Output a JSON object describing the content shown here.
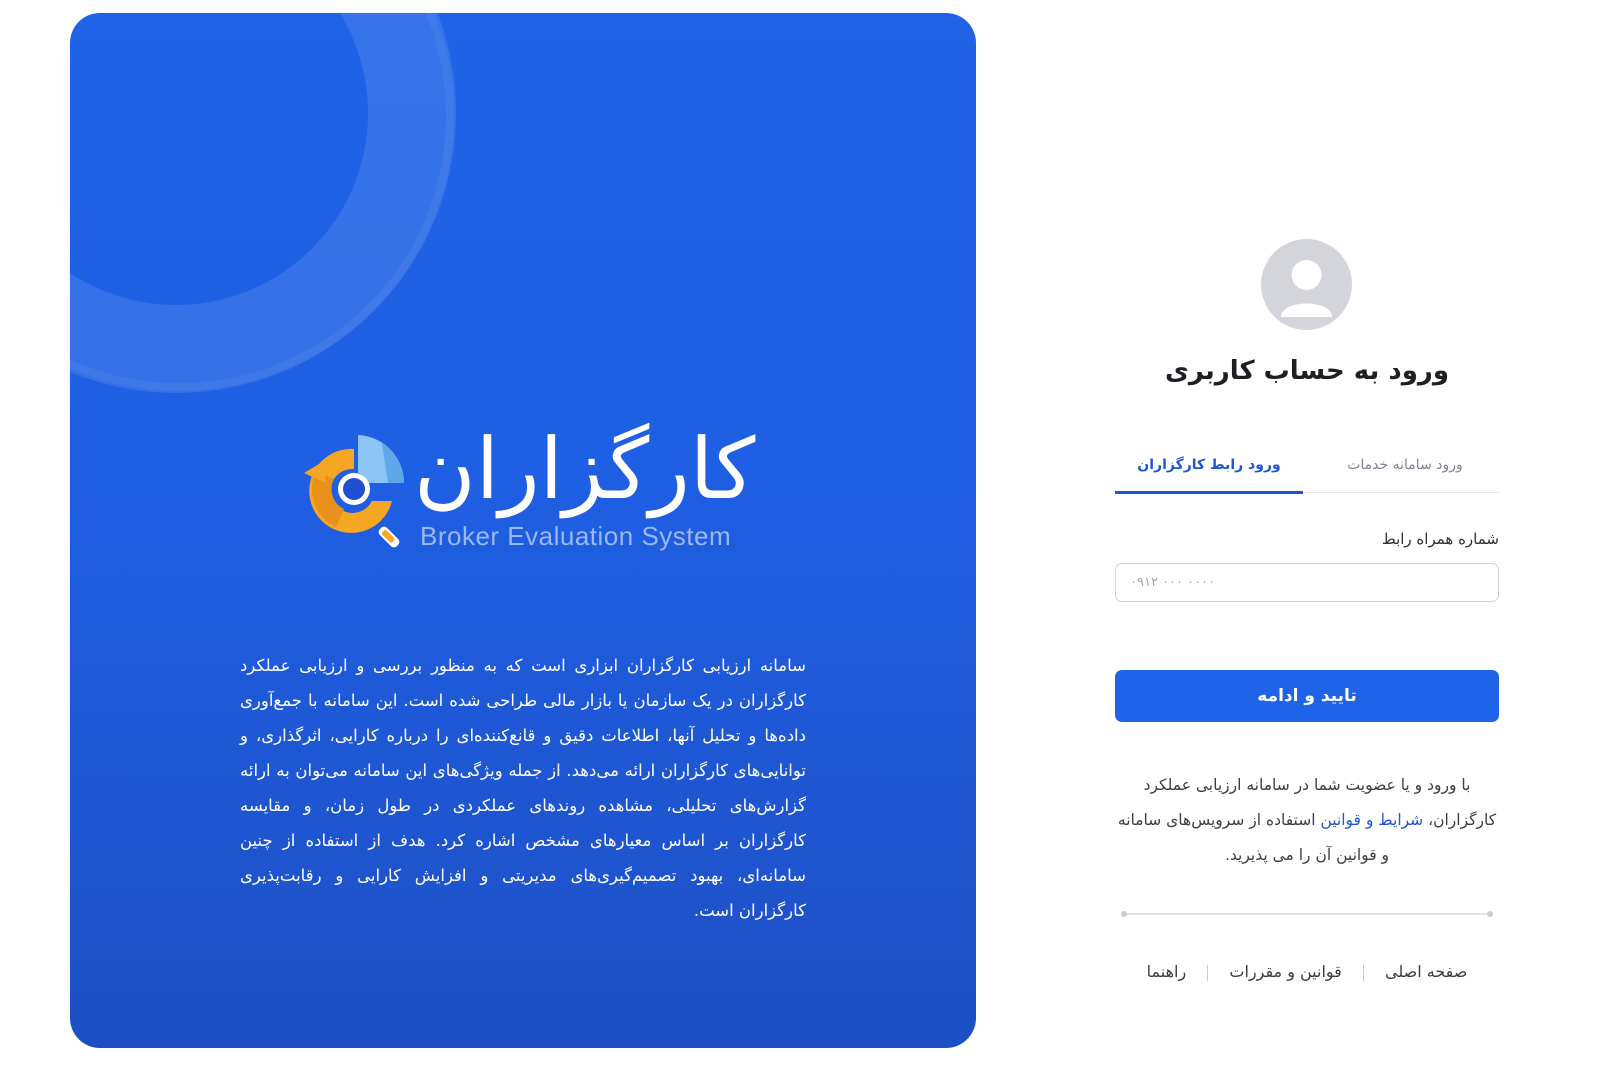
{
  "hero": {
    "logo_fa": "کارگزاران",
    "logo_en": "Broker Evaluation System",
    "description": "سامانه ارزیابی کارگزاران ابزاری است که به منظور بررسی و ارزیابی عملکرد کارگزاران در یک سازمان یا بازار مالی طراحی شده است. این سامانه با جمع‌آوری داده‌ها و تحلیل آنها، اطلاعات دقیق و قانع‌کننده‌ای را درباره کارایی، اثرگذاری، و توانایی‌های کارگزاران ارائه می‌دهد. از جمله ویژگی‌های این سامانه می‌توان به ارائه گزارش‌های تحلیلی، مشاهده روندهای عملکردی در طول زمان، و مقایسه کارگزاران بر اساس معیارهای مشخص اشاره کرد. هدف از استفاده از چنین سامانه‌ای، بهبود تصمیم‌گیری‌های مدیریتی و افزایش کارایی و رقابت‌پذیری کارگزاران است."
  },
  "login": {
    "title": "ورود به حساب کاربری",
    "tabs": [
      {
        "label": "ورود رابط کارگزاران",
        "active": true
      },
      {
        "label": "ورود سامانه خدمات",
        "active": false
      }
    ],
    "phone_label": "شماره همراه رابط",
    "phone_placeholder": "۰۹۱۲ ۰۰۰ ۰۰۰۰",
    "phone_value": "",
    "submit_label": "تایید و ادامه",
    "terms_before": "با ورود و یا عضویت شما در سامانه ارزیابی عملکرد کارگزاران، ",
    "terms_link": "شرایط و قوانین",
    "terms_after": " استفاده از سرویس‌های سامانه و قوانین آن را می پذیرید."
  },
  "footer": {
    "links": [
      "صفحه اصلی",
      "قوانین و مقررات",
      "راهنما"
    ]
  },
  "colors": {
    "brand_blue": "#1f63e8",
    "link_blue": "#1f56d6",
    "logo_orange": "#f5a623",
    "logo_light_blue": "#8cc4f5"
  },
  "icons": [
    "broker-logo-icon",
    "user-avatar-icon"
  ]
}
